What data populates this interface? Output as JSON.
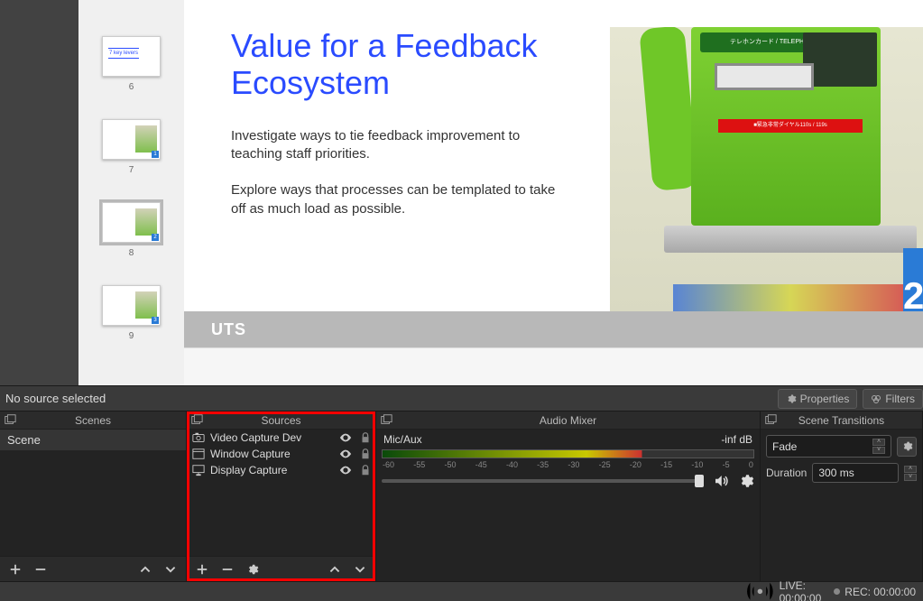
{
  "preview": {
    "thumbs": [
      {
        "num": "6",
        "label": "7 key levers",
        "badge": ""
      },
      {
        "num": "7",
        "label": "",
        "badge": "1"
      },
      {
        "num": "8",
        "label": "",
        "badge": "2",
        "selected": true
      },
      {
        "num": "9",
        "label": "",
        "badge": "3"
      }
    ],
    "slide": {
      "title": "Value for a Feedback Ecosystem",
      "para1": "Investigate ways to tie feedback improvement to teaching staff priorities.",
      "para2": "Explore ways that processes can be templated to take off as much load as possible.",
      "footer_brand": "UTS",
      "payphone_top": "テレホンカード / TELEPHONE CARD",
      "payphone_red": "■緊急非常ダイヤル110s / 119s",
      "bluebox_digit": "2"
    }
  },
  "toolbar": {
    "no_source": "No source selected",
    "properties": "Properties",
    "filters": "Filters"
  },
  "panels": {
    "scenes": {
      "title": "Scenes",
      "items": [
        "Scene"
      ]
    },
    "sources": {
      "title": "Sources",
      "items": [
        {
          "label": "Video Capture Dev",
          "icon": "camera"
        },
        {
          "label": "Window Capture",
          "icon": "window"
        },
        {
          "label": "Display Capture",
          "icon": "display"
        }
      ]
    },
    "mixer": {
      "title": "Audio Mixer",
      "channel": "Mic/Aux",
      "level": "-inf dB",
      "ticks": [
        "-60",
        "-55",
        "-50",
        "-45",
        "-40",
        "-35",
        "-30",
        "-25",
        "-20",
        "-15",
        "-10",
        "-5",
        "0"
      ]
    },
    "transitions": {
      "title": "Scene Transitions",
      "selected": "Fade",
      "duration_label": "Duration",
      "duration_value": "300 ms"
    }
  },
  "statusbar": {
    "live": "LIVE: 00:00:00",
    "rec": "REC: 00:00:00"
  }
}
